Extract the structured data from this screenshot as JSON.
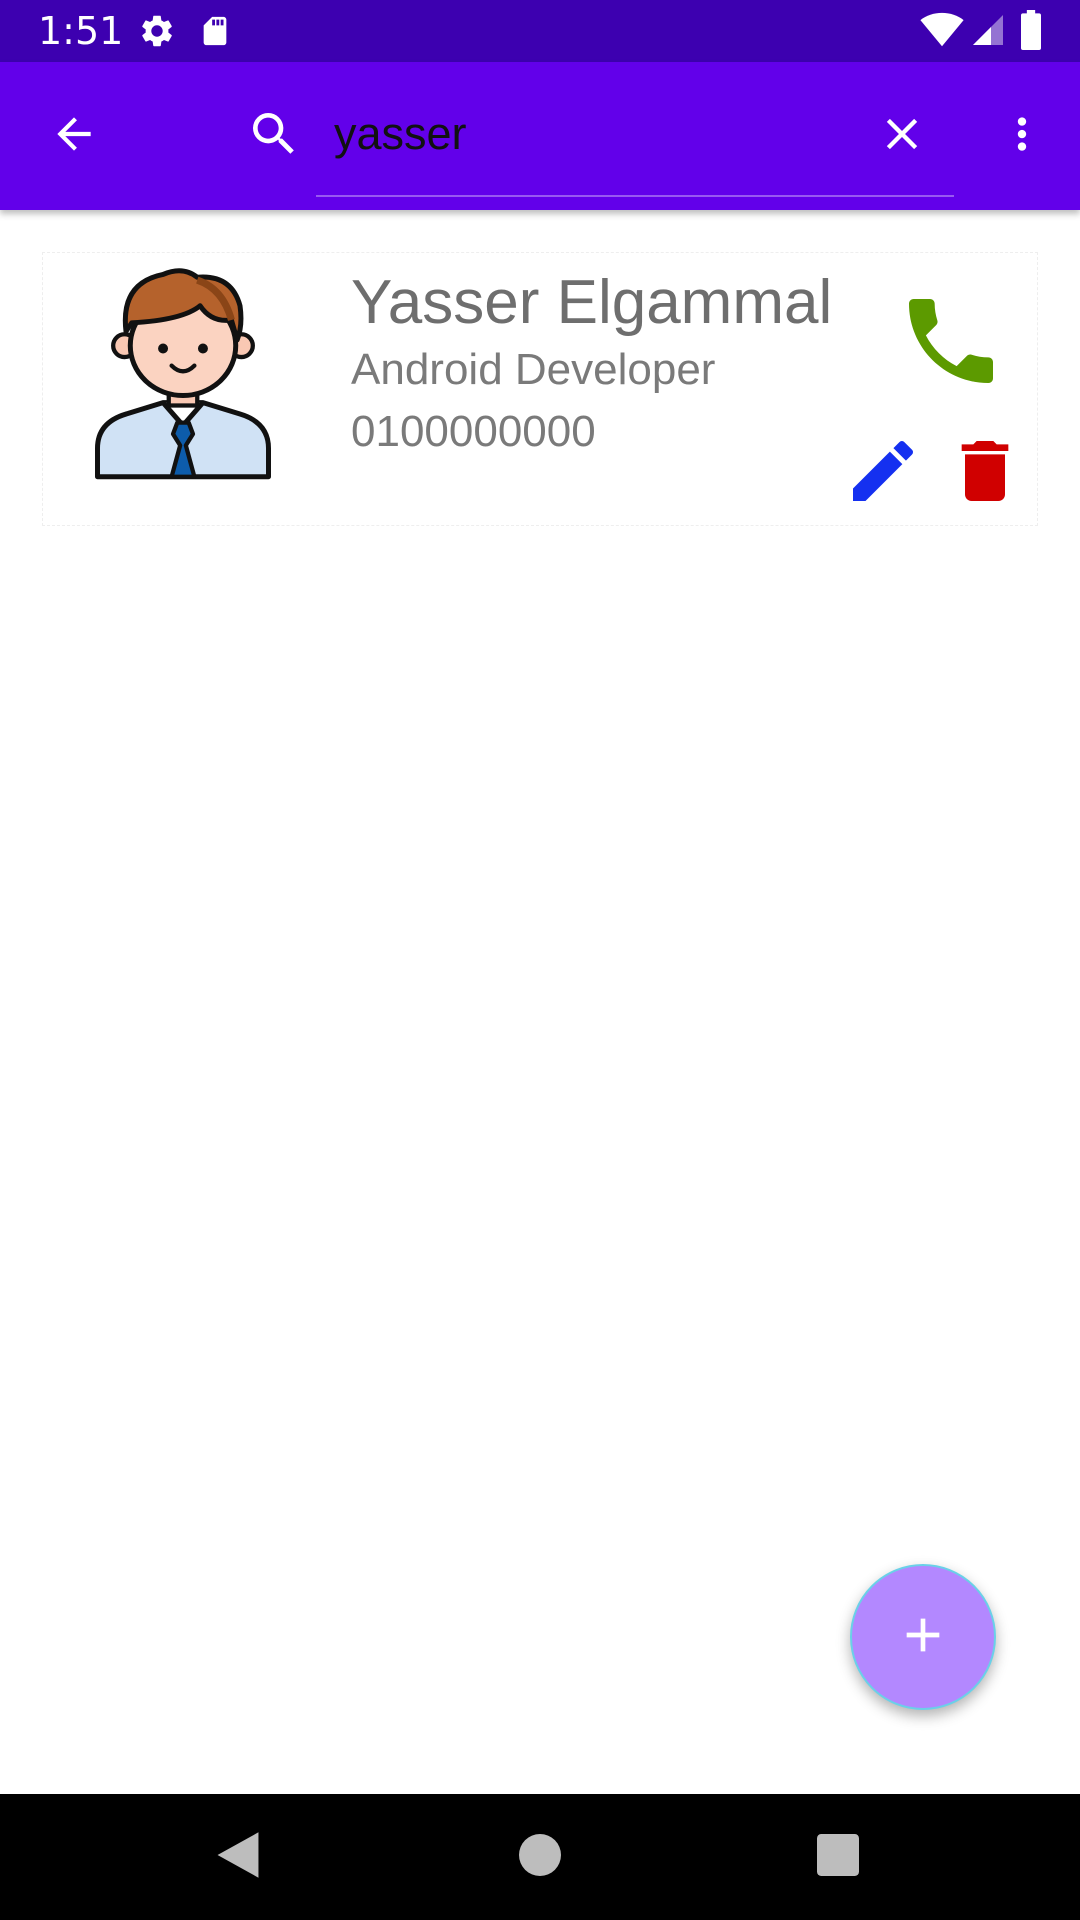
{
  "status_bar": {
    "time": "1:51",
    "icons": [
      "gear-icon",
      "sd-card-icon",
      "wifi-icon",
      "signal-icon",
      "battery-icon"
    ]
  },
  "toolbar": {
    "back_icon": "arrow-back-icon",
    "search_icon": "search-icon",
    "search_query": "yasser",
    "clear_icon": "close-icon",
    "overflow_icon": "more-vert-icon"
  },
  "contacts": [
    {
      "name": "Yasser Elgammal",
      "title": "Android Developer",
      "phone": "0100000000",
      "avatar": "man-avatar",
      "actions": [
        "phone-icon",
        "edit-icon",
        "delete-icon"
      ]
    }
  ],
  "fab": {
    "icon": "add-icon"
  },
  "nav_bar": {
    "icons": [
      "back-triangle-icon",
      "home-circle-icon",
      "recents-square-icon"
    ]
  },
  "colors": {
    "status_bar": "#3d00b0",
    "toolbar": "#6200ea",
    "call": "#5c9a00",
    "edit": "#1530f0",
    "delete": "#d00000",
    "fab": "#b388ff"
  }
}
